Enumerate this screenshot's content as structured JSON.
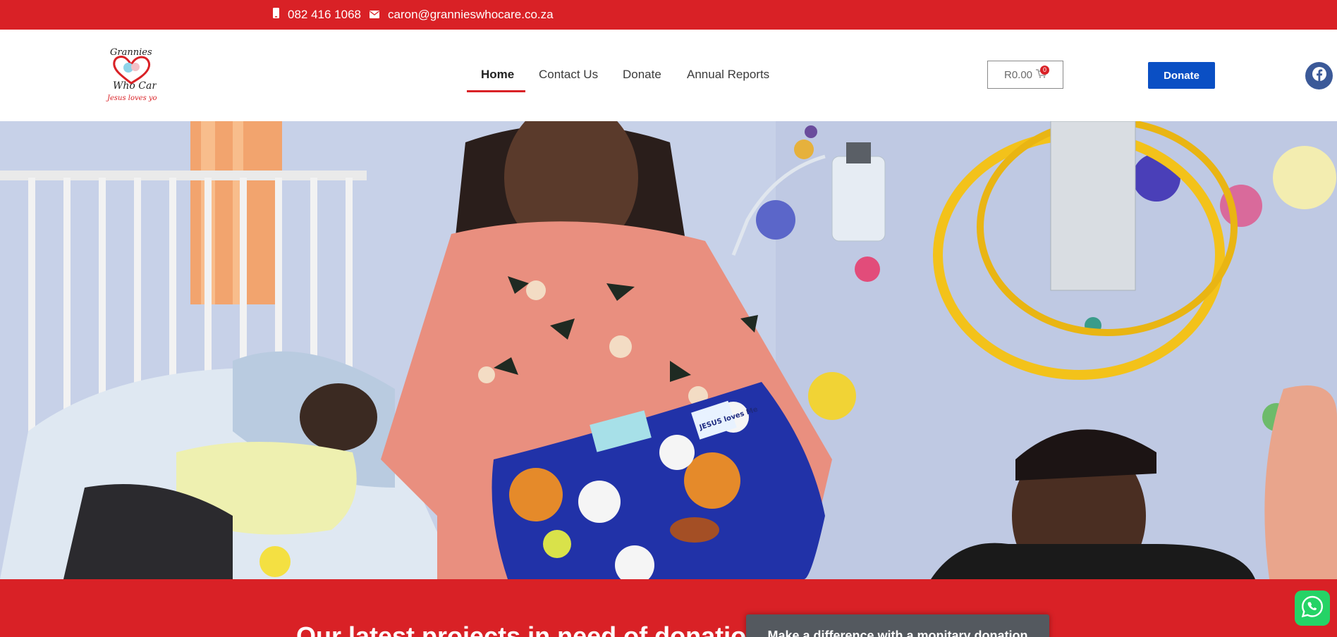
{
  "topbar": {
    "phone": "082 416 1068",
    "email": "caron@grannieswhocare.co.za",
    "phone_icon": "mobile-phone-icon",
    "email_icon": "envelope-icon"
  },
  "logo": {
    "line1": "Grannies",
    "line2": "Who Care",
    "tagline": "Jesus loves you!"
  },
  "nav": {
    "items": [
      {
        "label": "Home",
        "active": true
      },
      {
        "label": "Contact Us",
        "active": false
      },
      {
        "label": "Donate",
        "active": false
      },
      {
        "label": "Annual Reports",
        "active": false
      }
    ]
  },
  "cart": {
    "total": "R0.00",
    "count": "0",
    "icon": "shopping-cart-icon"
  },
  "header_donate": "Donate",
  "social": {
    "icon": "facebook-icon"
  },
  "hero": {
    "blanket_label": "JESUS loves Me"
  },
  "section": {
    "heading": "Our latest projects in need of donations",
    "money_button": "Make a difference with a monitary donation"
  },
  "whatsapp": {
    "icon": "whatsapp-icon"
  },
  "colors": {
    "brand_red": "#d92126",
    "donate_blue": "#0a4fc4",
    "facebook_blue": "#3b5998",
    "whatsapp_green": "#25d366",
    "button_gray": "#54595f"
  }
}
